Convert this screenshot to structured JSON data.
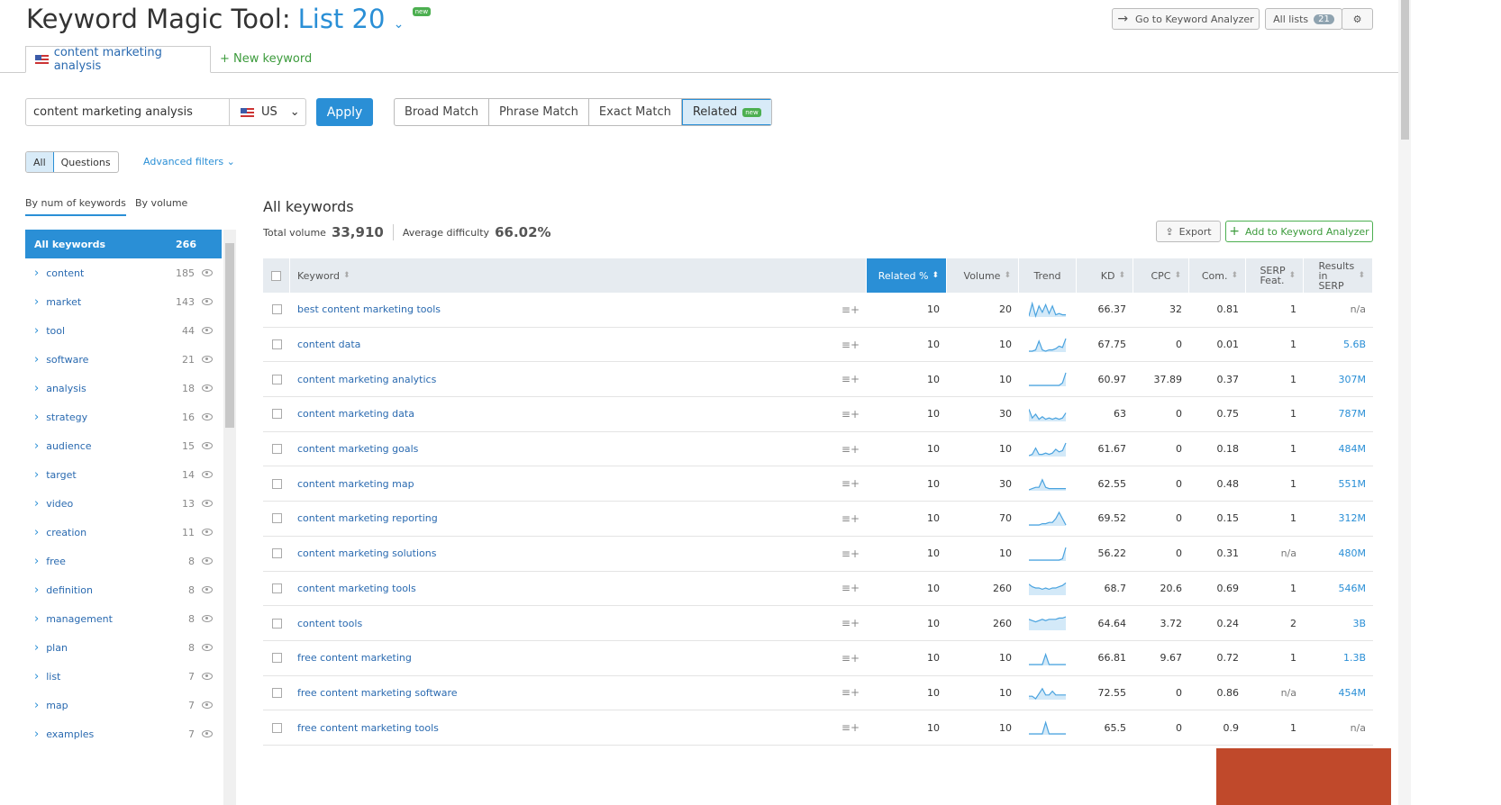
{
  "header": {
    "title": "Keyword Magic Tool:",
    "list_name": "List 20",
    "new_badge": "new",
    "go_analyzer": "Go to Keyword Analyzer",
    "all_lists": "All lists",
    "all_lists_count": "21"
  },
  "tabs": {
    "active": "content marketing analysis",
    "new_keyword": "New keyword"
  },
  "search": {
    "value": "content marketing analysis",
    "database": "US",
    "apply": "Apply"
  },
  "match": [
    "Broad Match",
    "Phrase Match",
    "Exact Match",
    "Related"
  ],
  "match_new_badge": "new",
  "filters": {
    "all": "All",
    "questions": "Questions",
    "advanced": "Advanced filters"
  },
  "sidebar": {
    "sort_tabs": [
      "By num of keywords",
      "By volume"
    ],
    "all": {
      "label": "All keywords",
      "count": "266"
    },
    "items": [
      [
        "content",
        "185"
      ],
      [
        "market",
        "143"
      ],
      [
        "tool",
        "44"
      ],
      [
        "software",
        "21"
      ],
      [
        "analysis",
        "18"
      ],
      [
        "strategy",
        "16"
      ],
      [
        "audience",
        "15"
      ],
      [
        "target",
        "14"
      ],
      [
        "video",
        "13"
      ],
      [
        "creation",
        "11"
      ],
      [
        "free",
        "8"
      ],
      [
        "definition",
        "8"
      ],
      [
        "management",
        "8"
      ],
      [
        "plan",
        "8"
      ],
      [
        "list",
        "7"
      ],
      [
        "map",
        "7"
      ],
      [
        "examples",
        "7"
      ]
    ]
  },
  "main": {
    "heading": "All keywords",
    "total_volume_label": "Total volume",
    "total_volume": "33,910",
    "avg_difficulty_label": "Average difficulty",
    "avg_difficulty": "66.02%",
    "export": "Export",
    "add_analyzer": "Add to Keyword Analyzer"
  },
  "table": {
    "columns": [
      "Keyword",
      "Related %",
      "Volume",
      "Trend",
      "KD",
      "CPC",
      "Com.",
      "SERP Feat.",
      "Results in SERP"
    ],
    "rows": [
      {
        "kw": "best content marketing tools",
        "rel": "10",
        "vol": "20",
        "trend": [
          0,
          1,
          0,
          0.8,
          0.3,
          0.9,
          0.2,
          0.8,
          0.1,
          0.2,
          0.1,
          0.1
        ],
        "kd": "66.37",
        "cpc": "32",
        "com": "0.81",
        "serp": "1",
        "res": "n/a"
      },
      {
        "kw": "content data",
        "rel": "10",
        "vol": "10",
        "trend": [
          0,
          0,
          0.1,
          0.8,
          0.1,
          0,
          0.1,
          0.1,
          0.2,
          0.4,
          0.3,
          1
        ],
        "kd": "67.75",
        "cpc": "0",
        "com": "0.01",
        "serp": "1",
        "res": "5.6B"
      },
      {
        "kw": "content marketing analytics",
        "rel": "10",
        "vol": "10",
        "trend": [
          0,
          0,
          0,
          0,
          0,
          0,
          0,
          0,
          0,
          0,
          0.2,
          1
        ],
        "kd": "60.97",
        "cpc": "37.89",
        "com": "0.37",
        "serp": "1",
        "res": "307M"
      },
      {
        "kw": "content marketing data",
        "rel": "10",
        "vol": "30",
        "trend": [
          0.9,
          0.2,
          0.5,
          0.1,
          0.3,
          0.1,
          0.2,
          0.1,
          0.2,
          0.1,
          0.2,
          0.6
        ],
        "kd": "63",
        "cpc": "0",
        "com": "0.75",
        "serp": "1",
        "res": "787M"
      },
      {
        "kw": "content marketing goals",
        "rel": "10",
        "vol": "10",
        "trend": [
          0,
          0.1,
          0.6,
          0.1,
          0.1,
          0.2,
          0.1,
          0.2,
          0.5,
          0.3,
          0.4,
          1
        ],
        "kd": "61.67",
        "cpc": "0",
        "com": "0.18",
        "serp": "1",
        "res": "484M"
      },
      {
        "kw": "content marketing map",
        "rel": "10",
        "vol": "30",
        "trend": [
          0,
          0.1,
          0.2,
          0.2,
          0.8,
          0.2,
          0.1,
          0.1,
          0.1,
          0.1,
          0.1,
          0.1
        ],
        "kd": "62.55",
        "cpc": "0",
        "com": "0.48",
        "serp": "1",
        "res": "551M"
      },
      {
        "kw": "content marketing reporting",
        "rel": "10",
        "vol": "70",
        "trend": [
          0,
          0,
          0,
          0,
          0.1,
          0.1,
          0.2,
          0.2,
          0.5,
          1,
          0.5,
          0
        ],
        "kd": "69.52",
        "cpc": "0",
        "com": "0.15",
        "serp": "1",
        "res": "312M"
      },
      {
        "kw": "content marketing solutions",
        "rel": "10",
        "vol": "10",
        "trend": [
          0,
          0,
          0,
          0,
          0,
          0,
          0,
          0,
          0,
          0,
          0.1,
          1
        ],
        "kd": "56.22",
        "cpc": "0",
        "com": "0.31",
        "serp": "n/a",
        "res": "480M"
      },
      {
        "kw": "content marketing tools",
        "rel": "10",
        "vol": "260",
        "trend": [
          0.8,
          0.6,
          0.5,
          0.5,
          0.4,
          0.5,
          0.4,
          0.5,
          0.5,
          0.6,
          0.7,
          0.9
        ],
        "kd": "68.7",
        "cpc": "20.6",
        "com": "0.69",
        "serp": "1",
        "res": "546M"
      },
      {
        "kw": "content tools",
        "rel": "10",
        "vol": "260",
        "trend": [
          0.8,
          0.7,
          0.6,
          0.7,
          0.8,
          0.7,
          0.8,
          0.8,
          0.8,
          0.9,
          0.9,
          1
        ],
        "kd": "64.64",
        "cpc": "3.72",
        "com": "0.24",
        "serp": "2",
        "res": "3B"
      },
      {
        "kw": "free content marketing",
        "rel": "10",
        "vol": "10",
        "trend": [
          0,
          0,
          0,
          0,
          0,
          0.8,
          0,
          0,
          0,
          0,
          0,
          0
        ],
        "kd": "66.81",
        "cpc": "9.67",
        "com": "0.72",
        "serp": "1",
        "res": "1.3B"
      },
      {
        "kw": "free content marketing software",
        "rel": "10",
        "vol": "10",
        "trend": [
          0.2,
          0.2,
          0,
          0.4,
          0.8,
          0.3,
          0.3,
          0.6,
          0.3,
          0.3,
          0.3,
          0.3
        ],
        "kd": "72.55",
        "cpc": "0",
        "com": "0.86",
        "serp": "n/a",
        "res": "454M"
      },
      {
        "kw": "free content marketing tools",
        "rel": "10",
        "vol": "10",
        "trend": [
          0,
          0,
          0,
          0,
          0,
          0.9,
          0,
          0,
          0,
          0,
          0,
          0
        ],
        "kd": "65.5",
        "cpc": "0",
        "com": "0.9",
        "serp": "1",
        "res": "n/a"
      }
    ]
  },
  "colors": {
    "accent": "#2a8fd6",
    "green": "#4caf50",
    "feedback": "#c0492b"
  }
}
